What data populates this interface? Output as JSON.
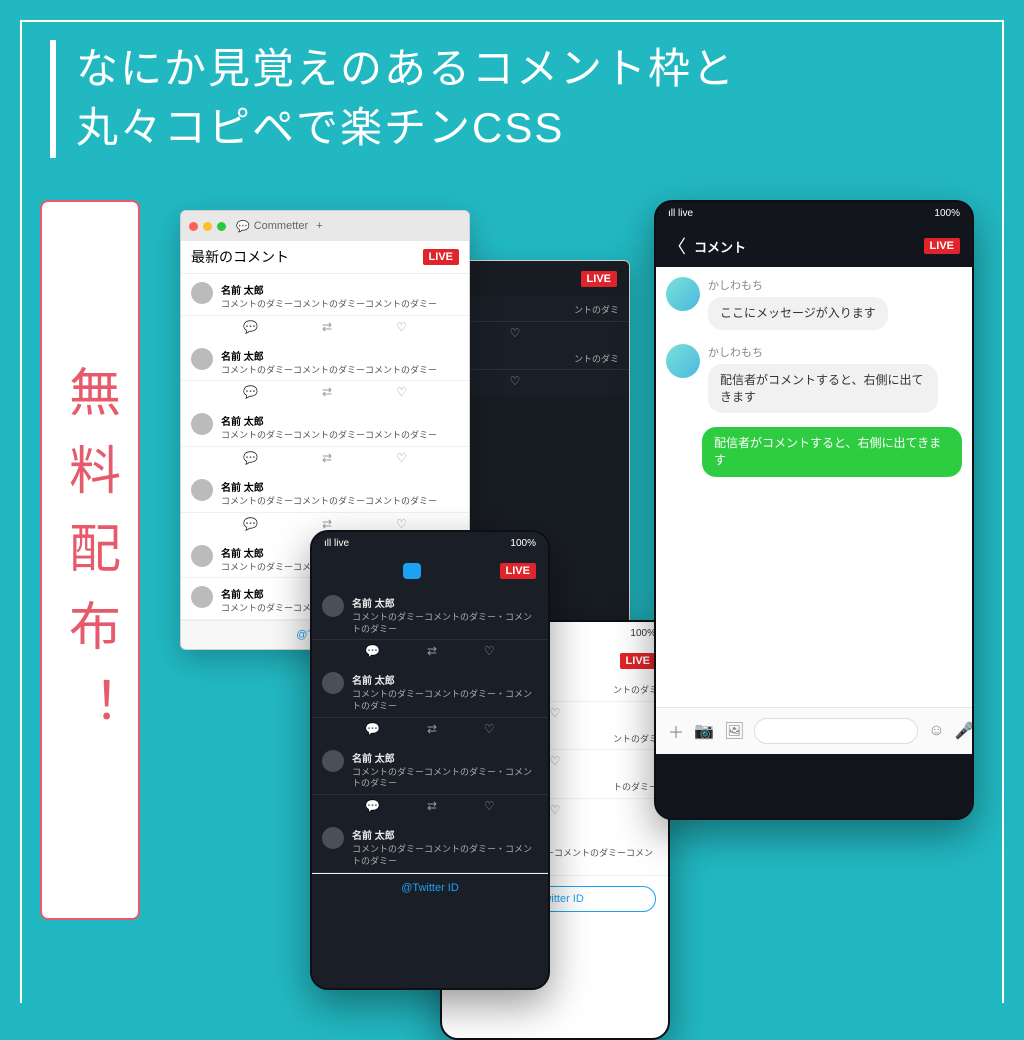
{
  "header": {
    "line1": "なにか見覚えのあるコメント枠と",
    "line2": "丸々コピペで楽チンCSS"
  },
  "badge_text": "無料配布！",
  "browser": {
    "tab_label": "Commetter",
    "tab_plus": "+",
    "title": "最新のコメント",
    "live": "LIVE",
    "twitter_id": "@Twitter ID",
    "comment_name": "名前 太郎",
    "comment_text": "コメントのダミーコメントのダミーコメントのダミー",
    "comment_text_short": "コメントのダミーコメントのダミー・コメントのダミー"
  },
  "phone_dark": {
    "status_left": "ıll live",
    "status_right": "100%",
    "live": "LIVE",
    "name": "名前 太郎",
    "text": "コメントのダミーコメントのダミー・コメントのダミー",
    "twitter_id": "@Twitter ID",
    "partial": "ントのダミ"
  },
  "phone_light_small": {
    "status_right": "100%",
    "live": "LIVE",
    "name": "名前 太郎",
    "text": "コメントのダミーコメントのダミーコメントのダミー",
    "partial1": "ントのダミ",
    "partial2": "トのダミー",
    "twitter_id": "@Twitter ID"
  },
  "line_phone": {
    "status_left": "ıll live",
    "status_right": "100%",
    "header": "コメント",
    "live": "LIVE",
    "user": "かしわもち",
    "msg1": "ここにメッセージが入ります",
    "msg2": "配信者がコメントすると、右側に出てきます",
    "msg3": "配信者がコメントすると、右側に出てきます"
  }
}
